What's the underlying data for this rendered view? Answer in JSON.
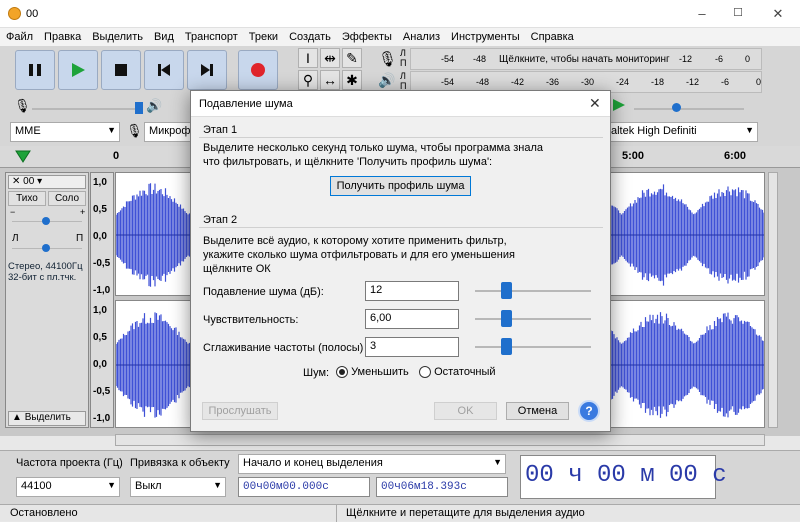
{
  "window": {
    "title": "00"
  },
  "menu": [
    "Файл",
    "Правка",
    "Выделить",
    "Вид",
    "Транспорт",
    "Треки",
    "Создать",
    "Эффекты",
    "Анализ",
    "Инструменты",
    "Справка"
  ],
  "meters": {
    "record_prompt": "Щёлкните, чтобы начать мониторинг",
    "record_scale": [
      "-54",
      "-48",
      "-12",
      "-6",
      "0"
    ],
    "play_scale": [
      "-54",
      "-48",
      "-42",
      "-36",
      "-30",
      "-24",
      "-18",
      "-12",
      "-6",
      "0"
    ],
    "l": "Л",
    "r": "П"
  },
  "device": {
    "host": "MME",
    "mic": "Микрофон",
    "output": "altek High Definiti"
  },
  "ruler": {
    "marks": [
      "0",
      "5:00",
      "6:00"
    ]
  },
  "track": {
    "name": "00",
    "mute": "Тихо",
    "solo": "Соло",
    "pan_l": "Л",
    "pan_r": "П",
    "info": "Стерео, 44100Гц\n32-бит с пл.тчк.",
    "select": "Выделить",
    "scale": [
      "1,0",
      "0,5",
      "0,0",
      "-0,5",
      "-1,0"
    ]
  },
  "dialog": {
    "title": "Подавление шума",
    "step1_label": "Этап 1",
    "step1_text": "Выделите несколько секунд только шума, чтобы программа знала что фильтровать, и щёлкните 'Получить профиль шума':",
    "get_profile_button": "Получить профиль шума",
    "step2_label": "Этап 2",
    "step2_text": "Выделите всё аудио, к которому хотите применить фильтр, укажите сколько шума отфильтровать и для его уменьшения щёлкните ОК",
    "params": [
      {
        "label": "Подавление шума (дБ):",
        "value": "12",
        "level": 0.27
      },
      {
        "label": "Чувствительность:",
        "value": "6,00",
        "level": 0.27
      },
      {
        "label": "Сглаживание частоты (полосы)",
        "value": "3",
        "level": 0.27
      }
    ],
    "noise_label": "Шум:",
    "reduce_option": "Уменьшить",
    "residue_option": "Остаточный",
    "preview_button": "Прослушать",
    "ok_button": "OK",
    "cancel_button": "Отмена",
    "help_button": "?"
  },
  "bottom": {
    "rate_label": "Частота проекта (Гц)",
    "rate_value": "44100",
    "snap_label": "Привязка к объекту",
    "snap_value": "Выкл",
    "selection_mode": "Начало и конец выделения",
    "sel_start": "00ч00м00.000с",
    "sel_end": "00ч06м18.393с",
    "big_time": "00 ч 00 м 00 с"
  },
  "status": {
    "left": "Остановлено",
    "center": "Щёлкните и перетащите для выделения аудио"
  },
  "colors": {
    "wave": "#3f51d6",
    "accent": "#1f6fcc"
  }
}
